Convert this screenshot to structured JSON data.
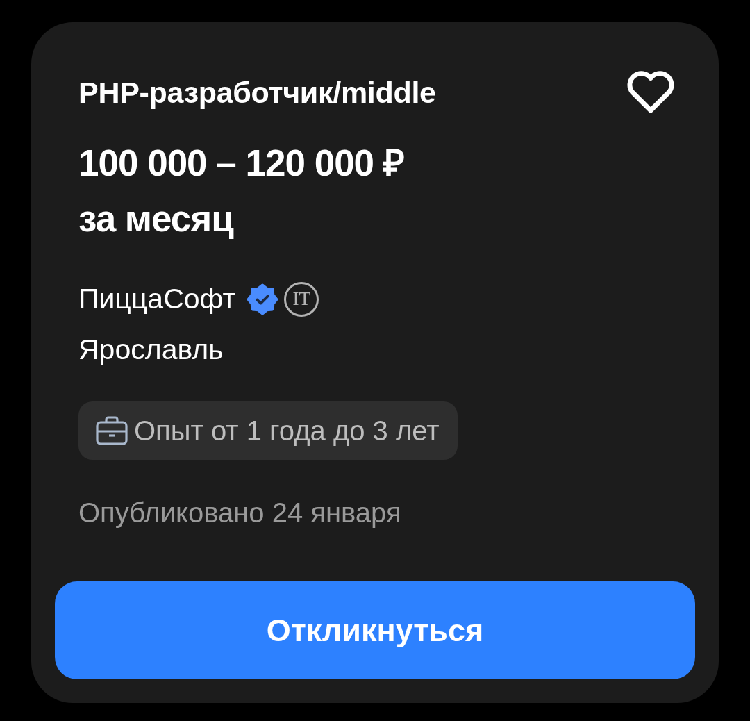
{
  "vacancy": {
    "title": "PHP-разработчик/middle",
    "favorite": false,
    "salary": "100 000 – 120 000 ₽",
    "salary_period": "за месяц",
    "company": "ПиццаСофт",
    "company_verified": true,
    "company_tag": "IT",
    "city": "Ярославль",
    "experience": "Опыт от 1 года до 3 лет",
    "published": "Опубликовано 24 января"
  },
  "apply_button": "Откликнуться"
}
